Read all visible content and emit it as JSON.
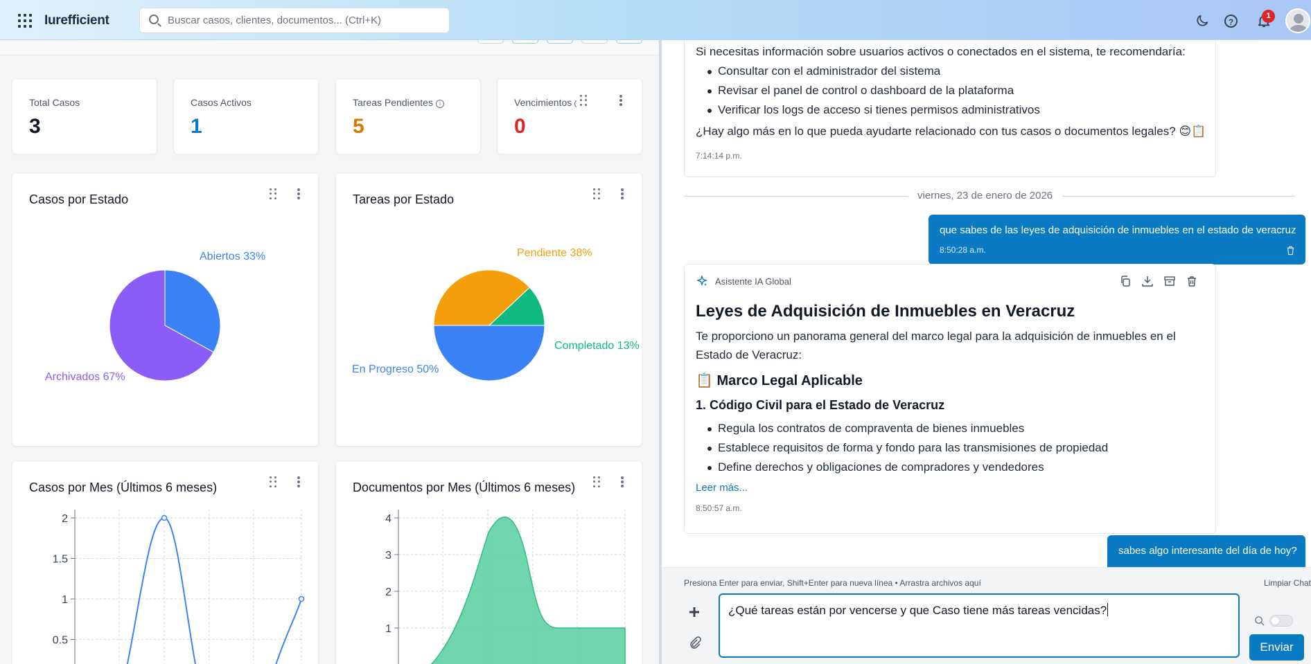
{
  "header": {
    "logo": "Iurefficient",
    "search_placeholder": "Buscar casos, clientes, documentos... (Ctrl+K)",
    "notification_count": "1",
    "help_glyph": "?"
  },
  "stats": [
    {
      "label": "Total Casos",
      "value": "3",
      "color": "#111827"
    },
    {
      "label": "Casos Activos",
      "value": "1",
      "color": "#0a7bc2"
    },
    {
      "label": "Tareas Pendientes",
      "value": "5",
      "color": "#d97706"
    },
    {
      "label": "Vencimientos",
      "value": "0",
      "color": "#dc2626"
    }
  ],
  "charts": {
    "casos_estado_title": "Casos por Estado",
    "tareas_estado_title": "Tareas por Estado",
    "casos_mes_title": "Casos por Mes (Últimos 6 meses)",
    "docs_mes_title": "Documentos por Mes (Últimos 6 meses)"
  },
  "chart_data": [
    {
      "type": "pie",
      "title": "Casos por Estado",
      "slices": [
        {
          "label": "Abiertos 33%",
          "value": 33,
          "color": "#3b82f6"
        },
        {
          "label": "Archivados 67%",
          "value": 67,
          "color": "#8b5cf6"
        }
      ]
    },
    {
      "type": "pie",
      "title": "Tareas por Estado",
      "slices": [
        {
          "label": "Pendiente 38%",
          "value": 38,
          "color": "#f59e0b"
        },
        {
          "label": "Completado 13%",
          "value": 12,
          "color": "#10b981"
        },
        {
          "label": "En Progreso 50%",
          "value": 50,
          "color": "#3b82f6"
        }
      ]
    },
    {
      "type": "line",
      "title": "Casos por Mes (Últimos 6 meses)",
      "y_ticks": [
        "2",
        "1.5",
        "1",
        "0.5"
      ],
      "ylim": [
        0,
        2
      ],
      "values": [
        0,
        2,
        0,
        0,
        1
      ],
      "color": "#3b82f6"
    },
    {
      "type": "area",
      "title": "Documentos por Mes (Últimos 6 meses)",
      "y_ticks": [
        "4",
        "3",
        "2",
        "1"
      ],
      "ylim": [
        0,
        4
      ],
      "values": [
        0,
        0,
        4,
        1,
        1
      ],
      "color": "#5fd0a4"
    }
  ],
  "chat": {
    "msg1": {
      "intro": "Si necesitas información sobre usuarios activos o conectados en el sistema, te recomendaría:",
      "bullets": [
        "Consultar con el administrador del sistema",
        "Revisar el panel de control o dashboard de la plataforma",
        "Verificar los logs de acceso si tienes permisos administrativos"
      ],
      "closing": "¿Hay algo más en lo que pueda ayudarte relacionado con tus casos o documentos legales? 😊📋",
      "time": "7:14:14 p.m."
    },
    "date_separator": "viernes, 23 de enero de 2026",
    "user1": {
      "text": "que sabes de las leyes de adquisición de inmuebles en el estado de veracruz",
      "time": "8:50:28 a.m."
    },
    "msg2": {
      "sender": "Asistente IA Global",
      "heading": "Leyes de Adquisición de Inmuebles en Veracruz",
      "p1": "Te proporciono un panorama general del marco legal para la adquisición de inmuebles en el",
      "p2": "Estado de Veracruz:",
      "h2": "📋 Marco Legal Aplicable",
      "h3": "1. Código Civil para el Estado de Veracruz",
      "bullets": [
        "Regula los contratos de compraventa de bienes inmuebles",
        "Establece requisitos de forma y fondo para las transmisiones de propiedad",
        "Define derechos y obligaciones de compradores y vendedores"
      ],
      "read_more": "Leer más...",
      "time": "8:50:57 a.m."
    },
    "user2": {
      "text": "sabes algo interesante del día de hoy?"
    },
    "composer": {
      "hint": "Presiona Enter para enviar, Shift+Enter para nueva línea • Arrastra archivos aquí",
      "clear": "Limpiar Chat",
      "value": "¿Qué tareas están por vencerse y que Caso tiene más tareas vencidas?",
      "send": "Enviar"
    }
  }
}
